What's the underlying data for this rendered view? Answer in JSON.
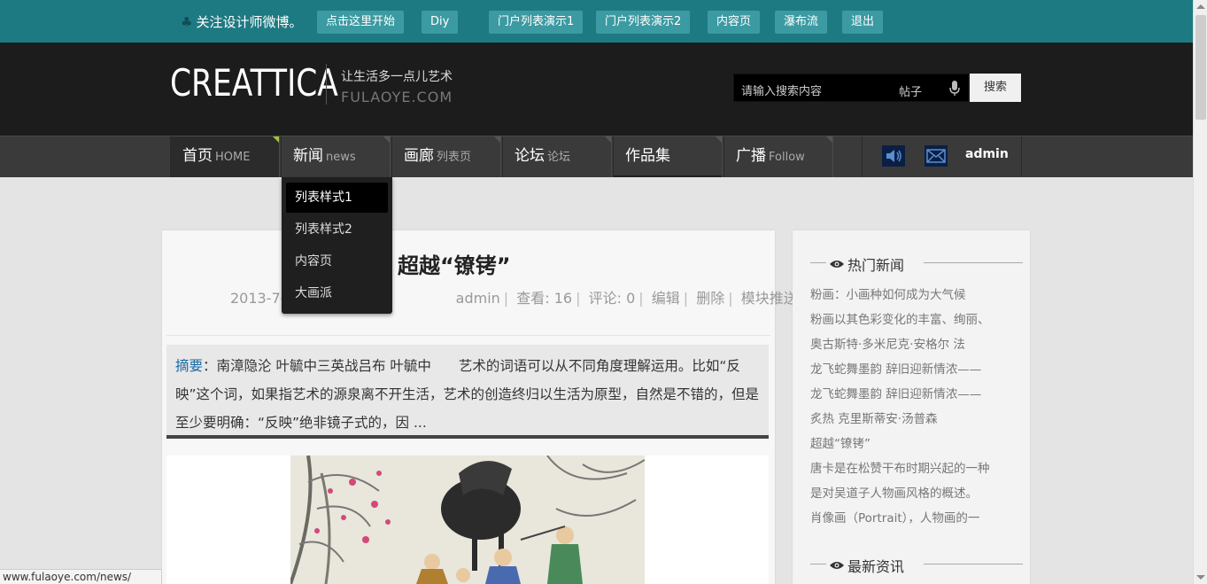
{
  "topbar": {
    "follow_text": "关注设计师微博。",
    "buttons": [
      "点击这里开始",
      "Diy",
      "门户列表演示1",
      "门户列表演示2",
      "内容页",
      "瀑布流",
      "退出"
    ]
  },
  "header": {
    "logo": "CREATTICA",
    "slogan": "让生活多一点儿艺术",
    "domain": "FULAOYE.COM",
    "search_placeholder": "请输入搜索内容",
    "search_type": "帖子",
    "search_button": "搜索"
  },
  "nav": {
    "items": [
      {
        "label": "首页",
        "sub": "HOME"
      },
      {
        "label": "新闻",
        "sub": "news"
      },
      {
        "label": "画廊",
        "sub": "列表页"
      },
      {
        "label": "论坛",
        "sub": "论坛"
      },
      {
        "label": "作品集",
        "sub": ""
      },
      {
        "label": "广播",
        "sub": "Follow"
      }
    ],
    "user": "admin"
  },
  "dropdown": {
    "items": [
      "列表样式1",
      "列表样式2",
      "内容页",
      "大画派"
    ]
  },
  "article": {
    "title": "超越“镣铐”",
    "date": "2013-7-",
    "author": "admin",
    "views": "查看: 16",
    "comments": "评论: 0",
    "edit": "编辑",
    "delete": "删除",
    "push": "模块推送",
    "summary_label": "摘要",
    "summary_text": "：南漳隐沦 叶毓中三英战吕布 叶毓中　　艺术的词语可以从不同角度理解运用。比如“反映”这个词，如果指艺术的源泉离不开生活，艺术的创造终归以生活为原型，自然是不错的，但是至少要明确：“反映”绝非镜子式的，因 ..."
  },
  "sidebar": {
    "hot_title": "热门新闻",
    "hot_items": [
      "粉画：小画种如何成为大气候",
      "粉画以其色彩变化的丰富、绚丽、",
      "奥古斯特·多米尼克·安格尔 法",
      "龙飞蛇舞墨韵 辞旧迎新情浓——",
      "龙飞蛇舞墨韵 辞旧迎新情浓——",
      "炙热 克里斯蒂安·汤普森",
      "超越“镣铐”",
      "唐卡是在松赞干布时期兴起的一种",
      "是对吴道子人物画风格的概述。",
      "肖像画（Portrait），人物画的一"
    ],
    "latest_title": "最新资讯"
  },
  "statusbar": {
    "url": "www.fulaoye.com/news/"
  }
}
